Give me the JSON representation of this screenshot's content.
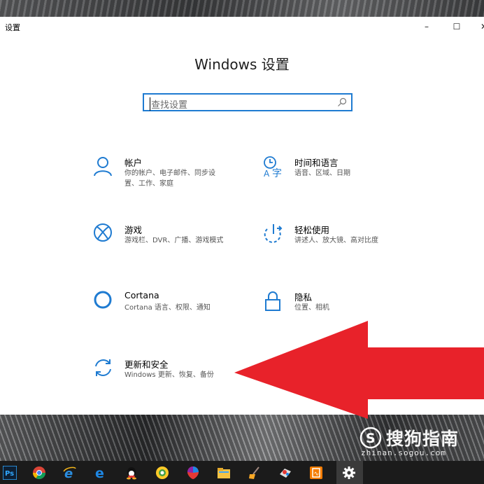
{
  "window": {
    "title": "设置",
    "minimize": "–",
    "maximize": "☐",
    "close": "✕"
  },
  "page": {
    "title": "Windows 设置"
  },
  "search": {
    "placeholder": "查找设置",
    "icon": "search-icon"
  },
  "tiles": [
    {
      "name": "帐户",
      "desc": "你的帐户、电子邮件、同步设置、工作、家庭",
      "icon": "person-icon"
    },
    {
      "name": "时间和语言",
      "desc": "语音、区域、日期",
      "icon": "time-language-icon"
    },
    {
      "name": "游戏",
      "desc": "游戏栏、DVR、广播、游戏模式",
      "icon": "xbox-icon"
    },
    {
      "name": "轻松使用",
      "desc": "讲述人、放大镜、高对比度",
      "icon": "ease-of-access-icon"
    },
    {
      "name": "Cortana",
      "desc": "Cortana 语言、权限、通知",
      "icon": "cortana-icon"
    },
    {
      "name": "隐私",
      "desc": "位置、相机",
      "icon": "lock-icon"
    },
    {
      "name": "更新和安全",
      "desc": "Windows 更新、恢复、备份",
      "icon": "update-sync-icon"
    }
  ],
  "taskbar": {
    "items": [
      "photoshop-icon",
      "chrome-icon",
      "ie-icon",
      "edge-icon",
      "qq-icon",
      "browser-icon",
      "paint-icon",
      "file-explorer-icon",
      "cleaner-icon",
      "app-icon",
      "notes-icon",
      "settings-icon"
    ],
    "ps_label": "Ps"
  },
  "watermark": {
    "main": "搜狗指南",
    "sub": "zhinan.sogou.com"
  },
  "colors": {
    "accent": "#1f7bd1",
    "arrow": "#e8222a"
  }
}
